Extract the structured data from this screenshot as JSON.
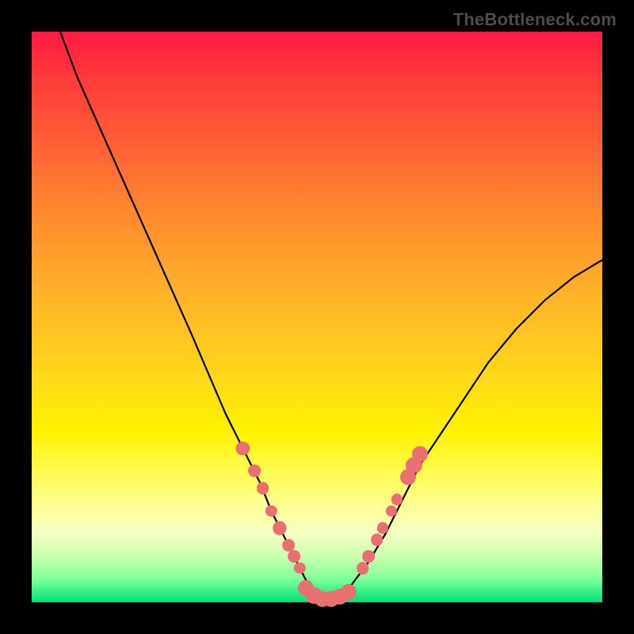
{
  "watermark": "TheBottleneck.com",
  "colors": {
    "dot": "#e87070",
    "curve": "#000000"
  },
  "chart_data": {
    "type": "line",
    "title": "",
    "xlabel": "",
    "ylabel": "",
    "xlim": [
      0,
      100
    ],
    "ylim": [
      0,
      100
    ],
    "annotations": [],
    "series": [
      {
        "name": "curve",
        "x": [
          5,
          8,
          12,
          16,
          20,
          24,
          28,
          31,
          34,
          37,
          40,
          42,
          44,
          46,
          48,
          50,
          52,
          54,
          56,
          59,
          62,
          65,
          68,
          72,
          76,
          80,
          85,
          90,
          95,
          100
        ],
        "y": [
          100,
          92,
          83,
          74,
          65,
          56,
          47,
          40,
          33,
          27,
          21,
          16,
          12,
          8,
          4,
          1,
          0,
          1,
          3,
          7,
          12,
          18,
          24,
          30,
          36,
          42,
          48,
          53,
          57,
          60
        ]
      }
    ],
    "markers": [
      {
        "x": 37,
        "y": 27,
        "r": 1.2
      },
      {
        "x": 39,
        "y": 23,
        "r": 1.1
      },
      {
        "x": 40.5,
        "y": 20,
        "r": 1.1
      },
      {
        "x": 42,
        "y": 16,
        "r": 1.0
      },
      {
        "x": 43.5,
        "y": 13,
        "r": 1.2
      },
      {
        "x": 45,
        "y": 10,
        "r": 1.1
      },
      {
        "x": 46,
        "y": 8,
        "r": 1.1
      },
      {
        "x": 47,
        "y": 6,
        "r": 1.0
      },
      {
        "x": 48,
        "y": 2.5,
        "r": 1.4
      },
      {
        "x": 49.5,
        "y": 1.2,
        "r": 1.4
      },
      {
        "x": 51,
        "y": 0.6,
        "r": 1.4
      },
      {
        "x": 52.5,
        "y": 0.6,
        "r": 1.4
      },
      {
        "x": 54,
        "y": 1.0,
        "r": 1.4
      },
      {
        "x": 55.5,
        "y": 1.8,
        "r": 1.4
      },
      {
        "x": 58,
        "y": 6,
        "r": 1.1
      },
      {
        "x": 59,
        "y": 8,
        "r": 1.1
      },
      {
        "x": 60.5,
        "y": 11,
        "r": 1.1
      },
      {
        "x": 61.5,
        "y": 13,
        "r": 1.0
      },
      {
        "x": 63,
        "y": 16,
        "r": 1.0
      },
      {
        "x": 64,
        "y": 18,
        "r": 1.0
      },
      {
        "x": 66,
        "y": 22,
        "r": 1.4
      },
      {
        "x": 67,
        "y": 24,
        "r": 1.4
      },
      {
        "x": 68,
        "y": 26,
        "r": 1.4
      }
    ]
  }
}
